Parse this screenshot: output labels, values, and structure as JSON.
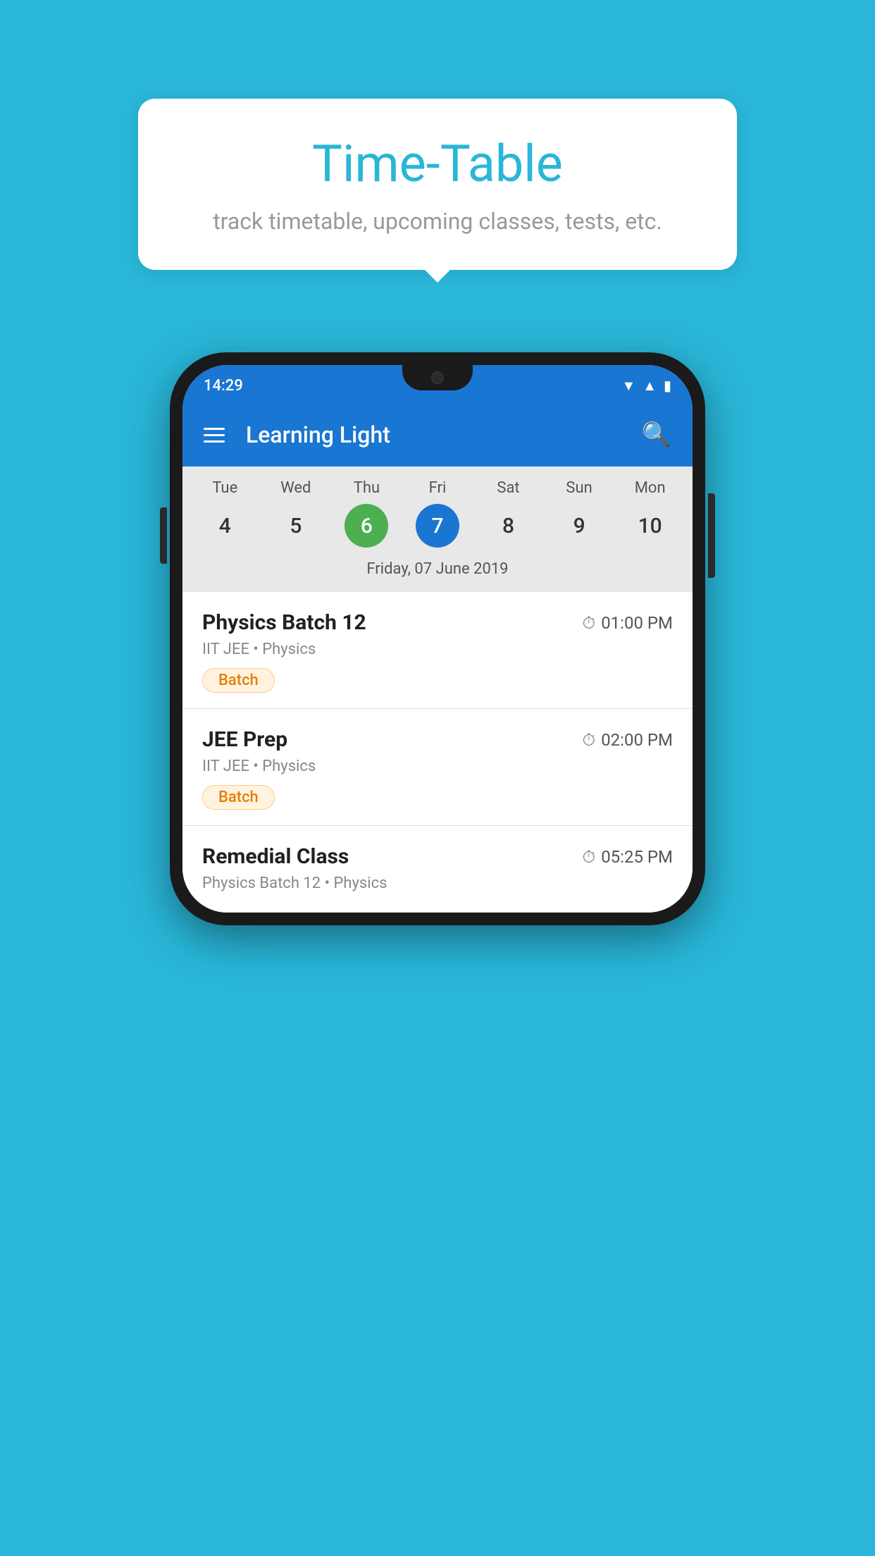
{
  "background_color": "#29b6d8",
  "bubble": {
    "title": "Time-Table",
    "subtitle": "track timetable, upcoming classes, tests, etc."
  },
  "phone": {
    "status_bar": {
      "time": "14:29"
    },
    "app_bar": {
      "title": "Learning Light"
    },
    "calendar": {
      "days": [
        {
          "name": "Tue",
          "num": "4",
          "state": "normal"
        },
        {
          "name": "Wed",
          "num": "5",
          "state": "normal"
        },
        {
          "name": "Thu",
          "num": "6",
          "state": "today"
        },
        {
          "name": "Fri",
          "num": "7",
          "state": "selected"
        },
        {
          "name": "Sat",
          "num": "8",
          "state": "normal"
        },
        {
          "name": "Sun",
          "num": "9",
          "state": "normal"
        },
        {
          "name": "Mon",
          "num": "10",
          "state": "normal"
        }
      ],
      "selected_date_label": "Friday, 07 June 2019"
    },
    "schedule": [
      {
        "title": "Physics Batch 12",
        "time": "01:00 PM",
        "subtitle": "IIT JEE • Physics",
        "tag": "Batch"
      },
      {
        "title": "JEE Prep",
        "time": "02:00 PM",
        "subtitle": "IIT JEE • Physics",
        "tag": "Batch"
      },
      {
        "title": "Remedial Class",
        "time": "05:25 PM",
        "subtitle": "Physics Batch 12 • Physics",
        "tag": ""
      }
    ]
  }
}
